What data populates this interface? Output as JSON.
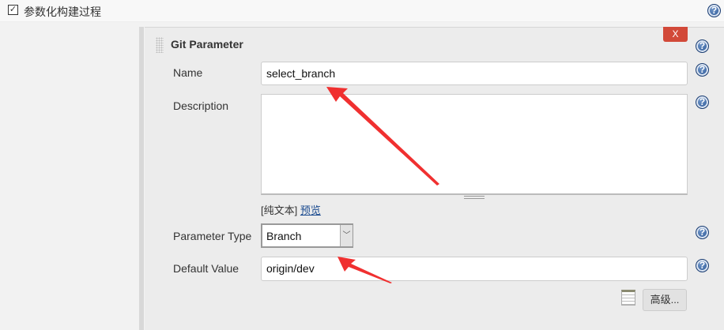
{
  "top": {
    "checkbox_checked": true,
    "checkbox_label": "参数化构建过程"
  },
  "panel": {
    "title": "Git Parameter",
    "delete_label": "X",
    "name_label": "Name",
    "name_value": "select_branch",
    "description_label": "Description",
    "description_value": "",
    "format_plain": "[纯文本]",
    "format_preview": "预览",
    "param_type_label": "Parameter Type",
    "param_type_value": "Branch",
    "default_label": "Default Value",
    "default_value": "origin/dev",
    "advanced_label": "高级..."
  },
  "help_glyph": "?",
  "colors": {
    "delete": "#d24939",
    "arrow": "#f03030",
    "link": "#1a4a8f"
  }
}
